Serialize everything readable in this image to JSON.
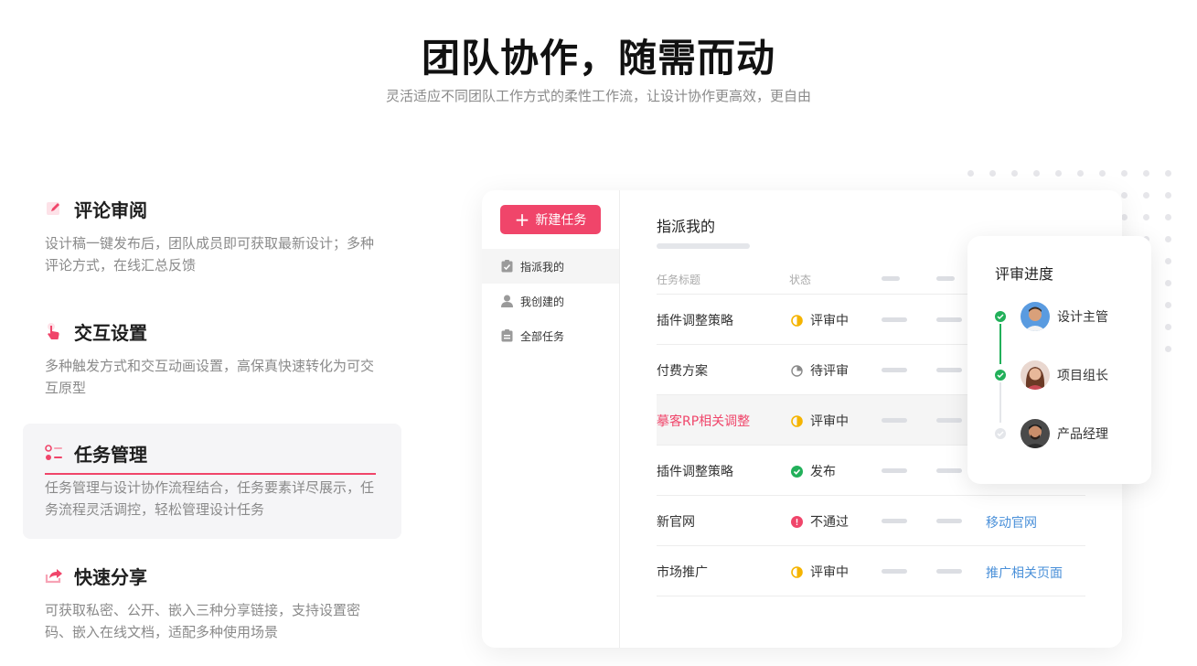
{
  "hero": {
    "title": "团队协作，随需而动",
    "subtitle": "灵活适应不同团队工作方式的柔性工作流，让设计协作更高效，更自由"
  },
  "features": [
    {
      "title": "评论审阅",
      "desc": "设计稿一键发布后，团队成员即可获取最新设计；多种评论方式，在线汇总反馈",
      "icon": "edit-icon"
    },
    {
      "title": "交互设置",
      "desc": "多种触发方式和交互动画设置，高保真快速转化为可交互原型",
      "icon": "pointer-hand-icon"
    },
    {
      "title": "任务管理",
      "desc": "任务管理与设计协作流程结合，任务要素详尽展示，任务流程灵活调控，轻松管理设计任务",
      "icon": "task-list-icon",
      "active": true
    },
    {
      "title": "快速分享",
      "desc": "可获取私密、公开、嵌入三种分享链接，支持设置密码、嵌入在线文档，适配多种使用场景",
      "icon": "share-icon"
    }
  ],
  "app": {
    "new_task_label": "新建任务",
    "sidebar": [
      {
        "label": "指派我的",
        "icon": "clipboard-check-icon",
        "active": true
      },
      {
        "label": "我创建的",
        "icon": "user-icon"
      },
      {
        "label": "全部任务",
        "icon": "clipboard-icon"
      }
    ],
    "main_title": "指派我的",
    "columns": {
      "title": "任务标题",
      "status": "状态"
    },
    "rows": [
      {
        "title": "插件调整策略",
        "status": "评审中",
        "status_icon": "half-circle-icon",
        "link": ""
      },
      {
        "title": "付费方案",
        "status": "待评审",
        "status_icon": "pie-clock-icon",
        "link": ""
      },
      {
        "title": "摹客RP相关调整",
        "status": "评审中",
        "status_icon": "half-circle-icon",
        "link": "",
        "highlight": true
      },
      {
        "title": "插件调整策略",
        "status": "发布",
        "status_icon": "check-circle-icon",
        "link": ""
      },
      {
        "title": "新官网",
        "status": "不通过",
        "status_icon": "alert-circle-icon",
        "link": "移动官网"
      },
      {
        "title": "市场推广",
        "status": "评审中",
        "status_icon": "half-circle-icon",
        "link": "推广相关页面"
      }
    ]
  },
  "review": {
    "title": "评审进度",
    "steps": [
      {
        "name": "设计主管",
        "done": true
      },
      {
        "name": "项目组长",
        "done": true
      },
      {
        "name": "产品经理",
        "done": false
      }
    ]
  },
  "colors": {
    "accent": "#f0456a",
    "success": "#22b05a",
    "warning": "#f5b400",
    "danger": "#f0456a",
    "link": "#4a90d9",
    "muted": "#8a8a8a"
  }
}
